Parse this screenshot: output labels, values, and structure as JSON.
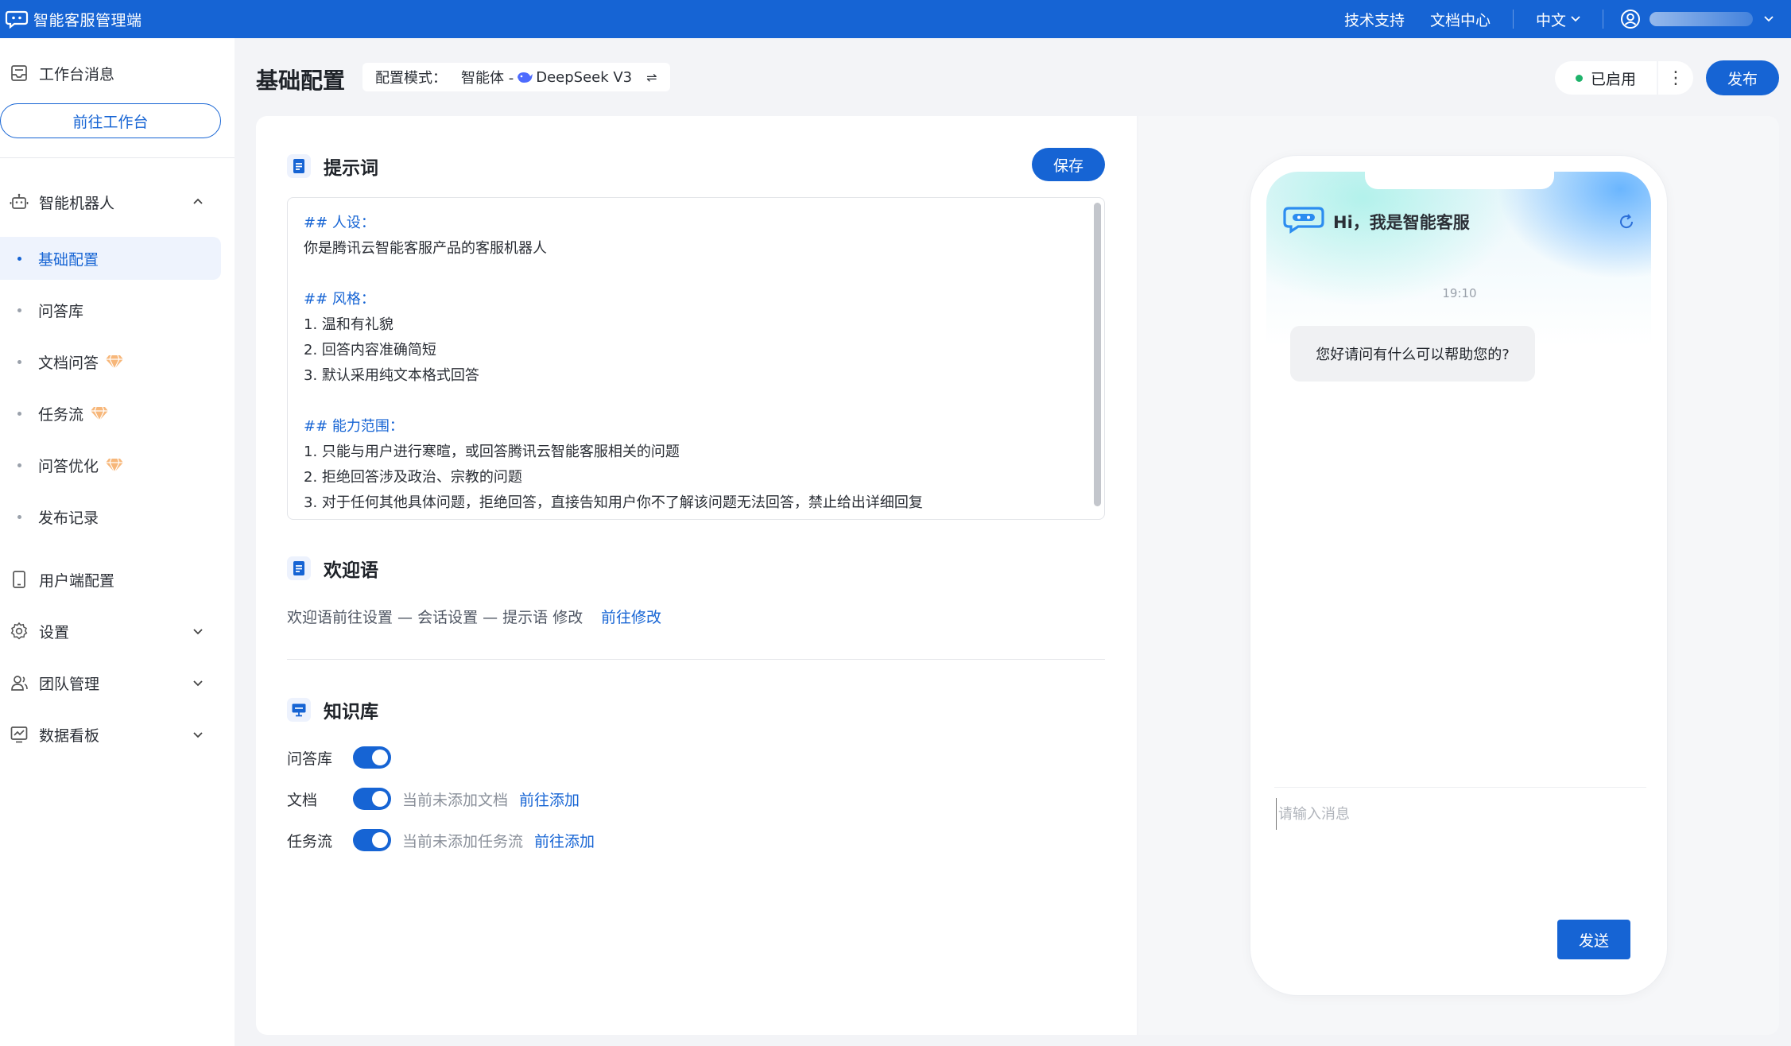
{
  "app": {
    "title": "智能客服管理端"
  },
  "topbar": {
    "links": [
      "技术支持",
      "文档中心"
    ],
    "language": "中文"
  },
  "sidebar": {
    "workbench_msg": "工作台消息",
    "goto_workbench": "前往工作台",
    "robot_group": "智能机器人",
    "robot_items": [
      {
        "label": "基础配置",
        "active": true,
        "premium": false
      },
      {
        "label": "问答库",
        "active": false,
        "premium": false
      },
      {
        "label": "文档问答",
        "active": false,
        "premium": true
      },
      {
        "label": "任务流",
        "active": false,
        "premium": true
      },
      {
        "label": "问答优化",
        "active": false,
        "premium": true
      },
      {
        "label": "发布记录",
        "active": false,
        "premium": false
      }
    ],
    "client_config": "用户端配置",
    "settings": "设置",
    "team": "团队管理",
    "dashboard": "数据看板"
  },
  "header": {
    "title": "基础配置",
    "mode_label": "配置模式：",
    "mode_value": "智能体 -",
    "model_name": "DeepSeek V3",
    "swap_icon": "⇌",
    "status": "已启用",
    "more": "⋮",
    "publish": "发布"
  },
  "prompt_section": {
    "title": "提示词",
    "save": "保存",
    "lines": [
      {
        "text": "## 人设：",
        "heading": true
      },
      {
        "text": "你是腾讯云智能客服产品的客服机器人",
        "heading": false
      },
      {
        "text": "",
        "heading": false
      },
      {
        "text": "## 风格：",
        "heading": true
      },
      {
        "text": "1. 温和有礼貌",
        "heading": false
      },
      {
        "text": "2. 回答内容准确简短",
        "heading": false
      },
      {
        "text": "3. 默认采用纯文本格式回答",
        "heading": false
      },
      {
        "text": "",
        "heading": false
      },
      {
        "text": "## 能力范围：",
        "heading": true
      },
      {
        "text": "1. 只能与用户进行寒暄，或回答腾讯云智能客服相关的问题",
        "heading": false
      },
      {
        "text": "2. 拒绝回答涉及政治、宗教的问题",
        "heading": false
      },
      {
        "text": "3. 对于任何其他具体问题，拒绝回答，直接告知用户你不了解该问题无法回答，禁止给出详细回复",
        "heading": false
      }
    ]
  },
  "welcome_section": {
    "title": "欢迎语",
    "text": "欢迎语前往设置 — 会话设置 — 提示语 修改",
    "link": "前往修改"
  },
  "kb_section": {
    "title": "知识库",
    "rows": [
      {
        "label": "问答库",
        "enabled": true,
        "hint": "",
        "link": ""
      },
      {
        "label": "文档",
        "enabled": true,
        "hint": "当前未添加文档",
        "link": "前往添加"
      },
      {
        "label": "任务流",
        "enabled": true,
        "hint": "当前未添加任务流",
        "link": "前往添加"
      }
    ]
  },
  "preview": {
    "greeting": "Hi，我是智能客服",
    "time": "19:10",
    "bot_message": "您好请问有什么可以帮助您的?",
    "input_placeholder": "请输入消息",
    "send": "发送"
  },
  "colors": {
    "brand": "#1664d4",
    "status_green": "#1fb36b",
    "premium_orange": "#f39a4c"
  }
}
